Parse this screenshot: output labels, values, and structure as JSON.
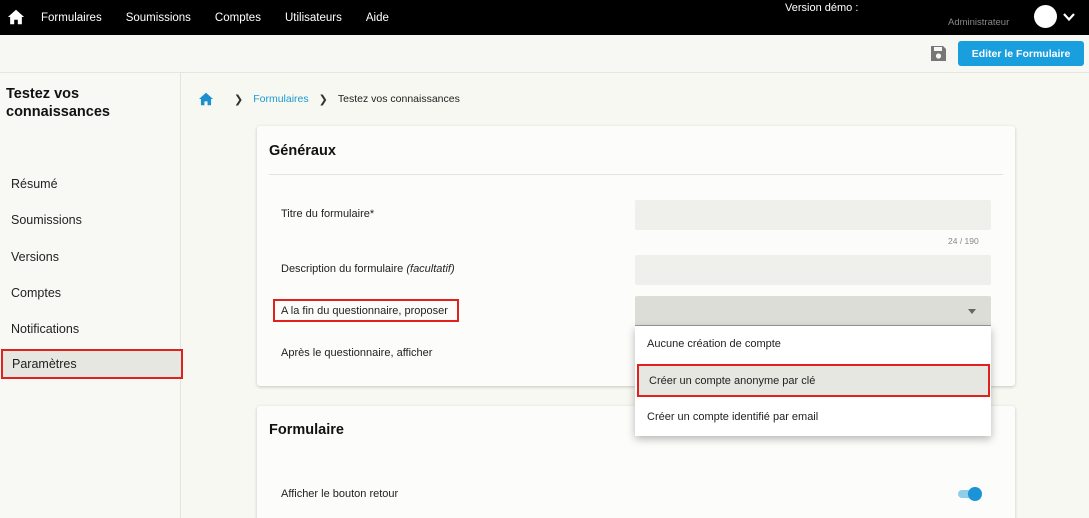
{
  "topbar": {
    "nav": [
      "Formulaires",
      "Soumissions",
      "Comptes",
      "Utilisateurs",
      "Aide"
    ],
    "version_label": "Version démo :",
    "user_label": "Administrateur"
  },
  "actions": {
    "edit_label": "Editer le Formulaire"
  },
  "sidebar": {
    "title": "Testez vos connaissances",
    "items": [
      {
        "label": "Résumé"
      },
      {
        "label": "Soumissions"
      },
      {
        "label": "Versions"
      },
      {
        "label": "Comptes"
      },
      {
        "label": "Notifications"
      },
      {
        "label": "Paramètres"
      }
    ],
    "active": "Paramètres"
  },
  "breadcrumb": {
    "link": "Formulaires",
    "current": "Testez vos connaissances"
  },
  "generaux": {
    "heading": "Généraux",
    "title_label": "Titre du formulaire*",
    "title_counter": "24 / 190",
    "description_label": "Description du formulaire",
    "description_optional": "(facultatif)",
    "propose_label": "A la fin du questionnaire, proposer",
    "afficher_label": "Après le questionnaire, afficher",
    "options": [
      "Aucune création de compte",
      "Créer un compte anonyme par clé",
      "Créer un compte identifié par email"
    ],
    "highlighted_option": "Créer un compte anonyme par clé"
  },
  "formulaire": {
    "heading": "Formulaire",
    "back_button_label": "Afficher le bouton retour",
    "back_button_enabled": true
  },
  "colors": {
    "accent": "#199ede",
    "highlight": "#e0221f",
    "topbar": "#000000"
  }
}
